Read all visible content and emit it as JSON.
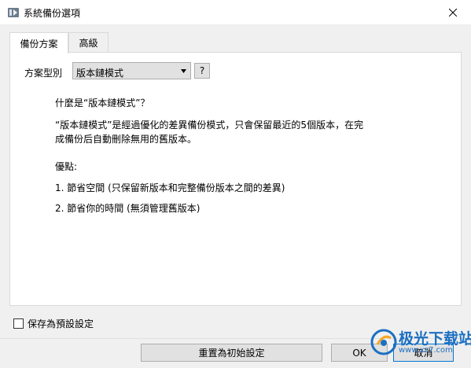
{
  "window": {
    "title": "系統備份選項"
  },
  "tabs": [
    {
      "label": "備份方案",
      "active": true
    },
    {
      "label": "高級",
      "active": false
    }
  ],
  "scheme": {
    "label": "方案型別",
    "selected": "版本鏈模式",
    "help_label": "?"
  },
  "description": {
    "question": "什麼是“版本鏈模式”？",
    "body_line1": "“版本鏈模式”是經過優化的差異備份模式，只會保留最近的5個版本，在完",
    "body_line2": "成備份后自動刪除無用的舊版本。",
    "advantages_title": "優點:",
    "advantage_1": "1. 節省空間 (只保留新版本和完整備份版本之間的差異)",
    "advantage_2": "2. 節省你的時間 (無須管理舊版本)"
  },
  "options": {
    "save_default_label": "保存為預設設定",
    "save_default_checked": false
  },
  "buttons": {
    "reset": "重置為初始設定",
    "ok": "OK",
    "cancel": "取消"
  },
  "watermark": {
    "brand": "极光下载站",
    "url": "www.xz7.com"
  },
  "colors": {
    "focus_border": "#0078d7",
    "watermark": "#1c6fc2"
  }
}
